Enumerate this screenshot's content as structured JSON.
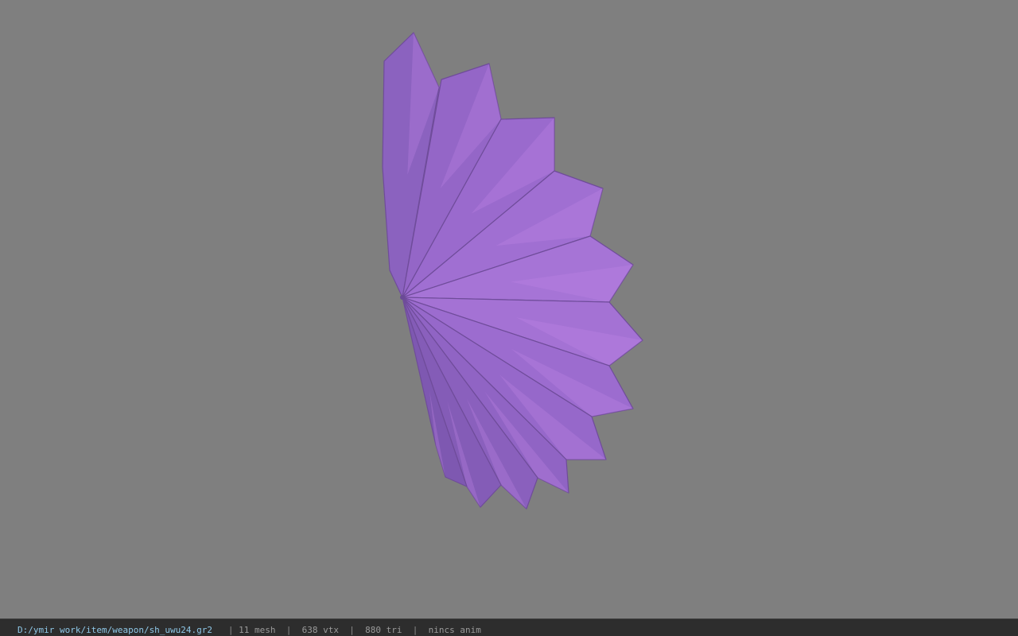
{
  "viewport": {
    "background": "#7f7f7f",
    "model": {
      "name": "purple folding fan",
      "color": "#9c6ad0",
      "highlight": "#c48ae8",
      "shadow": "#6f4c9a",
      "blade_count": 12
    }
  },
  "statusbar": {
    "file_path": "D:/ymir work/item/weapon/sh_uwu24.gr2",
    "separator": "|",
    "mesh_count": "11 mesh",
    "vertex_count": "638 vtx",
    "triangle_count": "880 tri",
    "animation": "nincs anim"
  }
}
